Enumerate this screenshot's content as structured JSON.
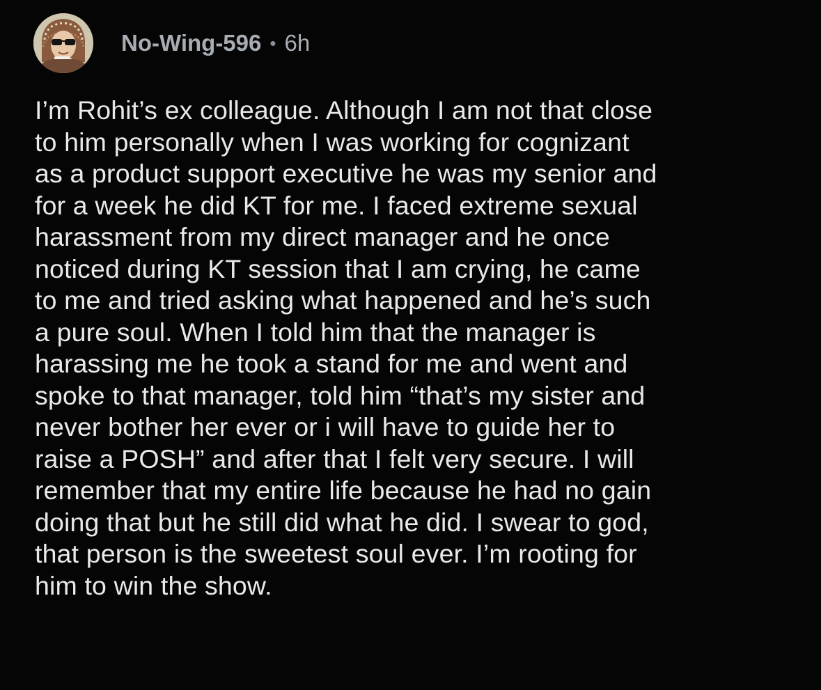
{
  "post": {
    "username": "No-Wing-596",
    "separator": "•",
    "time": "6h",
    "avatar_icon": "user-avatar-icon",
    "body_lines": [
      "I’m Rohit’s ex colleague. Although I am not that close",
      "to him personally when I was working for cognizant",
      "as a product support executive he was my senior and",
      "for a week he did KT for me. I faced extreme sexual",
      "harassment from my direct manager and he once",
      "noticed during KT session that I am crying, he came",
      "to me and tried asking what happened and he’s such",
      "a pure soul. When I told him that the manager is",
      "harassing me he took a stand for me and went and",
      "spoke to that manager, told him “that’s my sister and",
      "never bother her ever or i will have to guide her to",
      "raise a POSH” and after that I felt very secure. I will",
      "remember that my entire life because he had no gain",
      "doing that but he still did what he did. I swear to god,",
      "that person is the sweetest soul ever. I’m rooting for",
      "him to win the show."
    ]
  },
  "colors": {
    "background": "#050505",
    "text": "#e9e9e9",
    "meta": "#a7adb3"
  }
}
